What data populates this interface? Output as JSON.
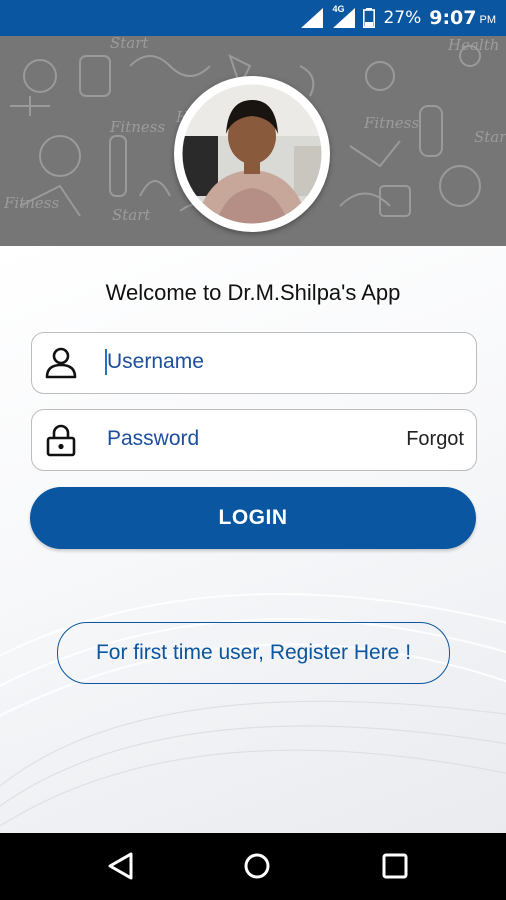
{
  "status_bar": {
    "network": "4G",
    "battery": "27%",
    "time": "9:07",
    "ampm": "PM"
  },
  "header": {
    "doodle_words": [
      "Start",
      "Fitness",
      "Health",
      "Start",
      "Fitness",
      "Start",
      "Fitness",
      "Health"
    ],
    "avatar_icon": "doctor-photo"
  },
  "main": {
    "welcome": "Welcome to Dr.M.Shilpa's App",
    "username": {
      "placeholder": "Username",
      "icon": "user-icon"
    },
    "password": {
      "placeholder": "Password",
      "icon": "lock-icon",
      "forgot": "Forgot"
    },
    "login_label": "LOGIN",
    "register_label": "For first time user, Register Here !"
  },
  "nav_bar": {
    "buttons": [
      "back-icon",
      "home-icon",
      "recents-icon"
    ]
  },
  "colors": {
    "primary": "#0a56a0",
    "header_bg": "#767676",
    "text_blue": "#1c4f9c"
  }
}
